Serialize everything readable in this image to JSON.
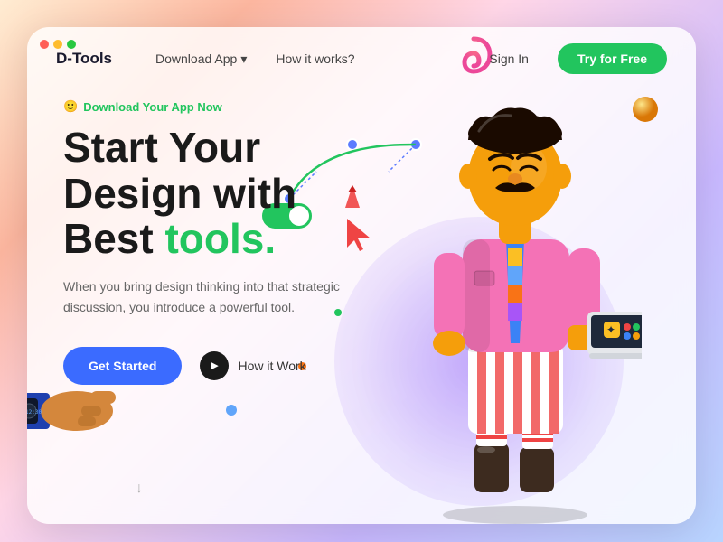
{
  "meta": {
    "bg_gradient": "linear-gradient(135deg, #ffecd2 0%, #fcb69f 20%, #ffd6e7 40%, #c9b8ff 70%, #b8d4ff 100%)"
  },
  "navbar": {
    "logo": "D-Tools",
    "links": [
      {
        "label": "Download App",
        "has_arrow": true
      },
      {
        "label": "How it works?"
      }
    ],
    "signin_label": "Sign In",
    "cta_label": "Try for Free"
  },
  "hero": {
    "tag_emoji": "🙂",
    "tag_text": "Download Your App Now",
    "title_line1": "Start Your",
    "title_line2": "Design with",
    "title_line3_plain": "Best ",
    "title_line3_accent": "tools.",
    "description": "When you bring design thinking into that strategic discussion, you introduce a powerful tool.",
    "btn_primary": "Get Started",
    "btn_secondary": "How it Work"
  },
  "decorations": {
    "sphere_color": "#f59e0b",
    "blob_color": "rgba(139,92,246,0.4)",
    "dot_blue": "#60a5fa",
    "dot_orange": "#f97316",
    "dot_green": "#22c55e"
  }
}
